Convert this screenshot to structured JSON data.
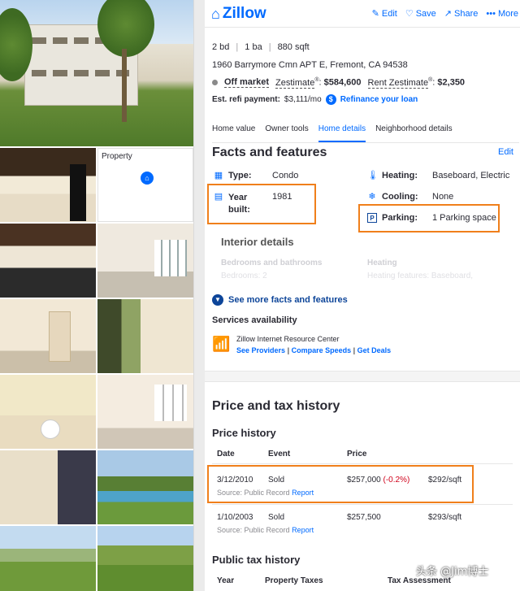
{
  "gallery": {
    "map_label": "Property"
  },
  "header": {
    "logo": "Zillow",
    "actions": {
      "edit": "Edit",
      "save": "Save",
      "share": "Share",
      "more": "More"
    }
  },
  "summary": {
    "beds": "2 bd",
    "baths": "1 ba",
    "sqft": "880 sqft",
    "address": "1960 Barrymore Cmn APT E, Fremont, CA 94538",
    "status": "Off market",
    "zestimate_label": "Zestimate",
    "zestimate_value": "$584,600",
    "rent_label": "Rent Zestimate",
    "rent_value": "$2,350",
    "refi_label": "Est. refi payment:",
    "refi_value": "$3,111/mo",
    "refi_link": "Refinance your loan"
  },
  "tabs": [
    "Home value",
    "Owner tools",
    "Home details",
    "Neighborhood details"
  ],
  "facts": {
    "title": "Facts and features",
    "edit": "Edit",
    "type_label": "Type:",
    "type_value": "Condo",
    "heating_label": "Heating:",
    "heating_value": "Baseboard, Electric",
    "year_label": "Year built:",
    "year_value": "1981",
    "cooling_label": "Cooling:",
    "cooling_value": "None",
    "parking_label": "Parking:",
    "parking_value": "1 Parking space",
    "interior_title": "Interior details",
    "bed_bath_heading": "Bedrooms and bathrooms",
    "bedrooms_line": "Bedrooms: 2",
    "heating_heading": "Heating",
    "heating_features_line": "Heating features: Baseboard,",
    "see_more": "See more facts and features"
  },
  "services": {
    "title": "Services availability",
    "provider": "Zillow Internet Resource Center",
    "link1": "See Providers",
    "link2": "Compare Speeds",
    "link3": "Get Deals"
  },
  "price_tax": {
    "title": "Price and tax history",
    "price_history_title": "Price history",
    "columns": [
      "Date",
      "Event",
      "Price"
    ],
    "rows": [
      {
        "date": "3/12/2010",
        "event": "Sold",
        "price": "$257,000",
        "change": "(-0.2%)",
        "per_sqft": "$292/sqft",
        "source": "Source: Public Record",
        "report": "Report"
      },
      {
        "date": "1/10/2003",
        "event": "Sold",
        "price": "$257,500",
        "change": "",
        "per_sqft": "$293/sqft",
        "source": "Source: Public Record",
        "report": "Report"
      }
    ],
    "tax_title": "Public tax history",
    "tax_columns": [
      "Year",
      "Property Taxes",
      "Tax Assessment"
    ]
  },
  "watermark": "头条 @Jim博士",
  "colors": {
    "brand": "#006aff",
    "highlight": "#f07f1b",
    "negative": "#d0021b"
  }
}
